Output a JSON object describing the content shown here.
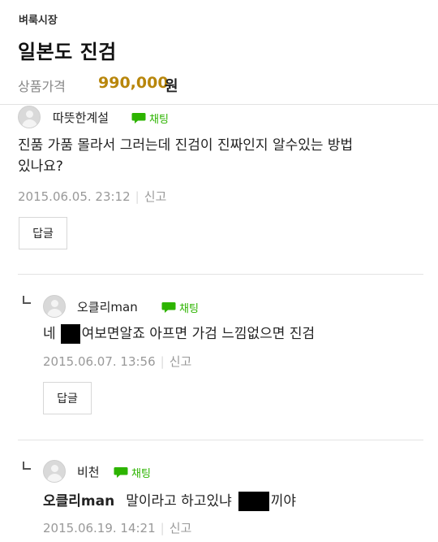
{
  "header": {
    "market": "벼룩시장",
    "title": "일본도 진검",
    "price_label": "상품가격",
    "price_value": "990,000",
    "price_unit": "원"
  },
  "comments": [
    {
      "nickname": "따뜻한계설",
      "chat_label": "채팅",
      "text_line1": "진품 가품 몰라서 그러는데 진검이 진짜인지 알수있는 방법",
      "text_line2": "있나요?",
      "date": "2015.06.05. 23:12",
      "report": "신고",
      "reply_button": "답글"
    },
    {
      "nickname": "오클리man",
      "chat_label": "채팅",
      "text_before": "네",
      "text_after": "여보면알죠 아프면 가검 느낌없으면 진검",
      "date": "2015.06.07. 13:56",
      "report": "신고",
      "reply_button": "답글"
    },
    {
      "nickname": "비천",
      "chat_label": "채팅",
      "mention": "오클리man",
      "text_before": "말이라고 하고있냐",
      "text_after": "끼야",
      "date": "2015.06.19. 14:21",
      "report": "신고"
    }
  ],
  "colors": {
    "price": "#b8860b",
    "chat": "#2db400",
    "meta": "#999999"
  }
}
